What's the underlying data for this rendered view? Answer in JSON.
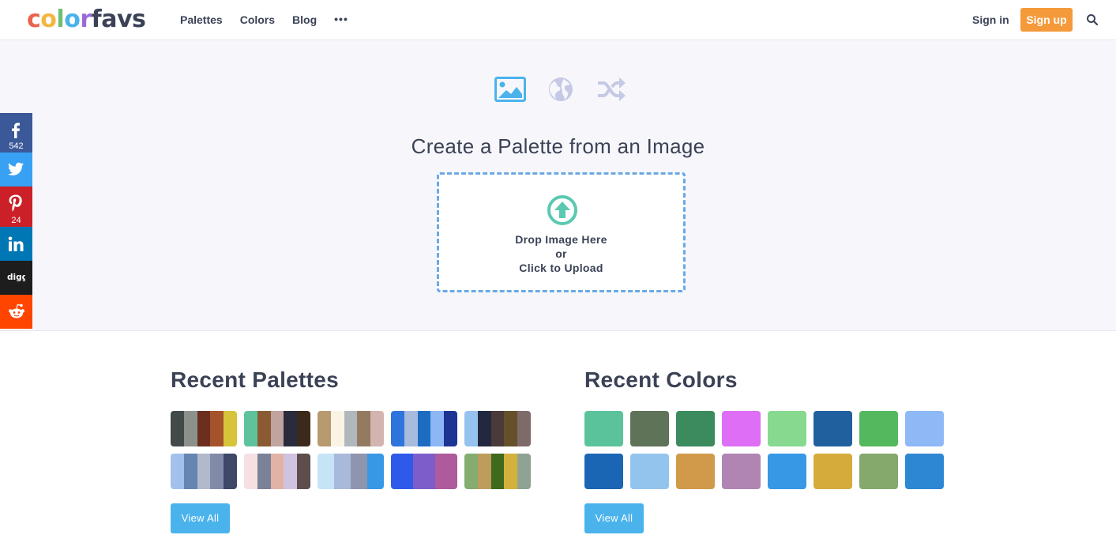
{
  "header": {
    "logo_letters": [
      {
        "ch": "c",
        "color": "#e9634a"
      },
      {
        "ch": "o",
        "color": "#f4b63f"
      },
      {
        "ch": "l",
        "color": "#6cc070"
      },
      {
        "ch": "o",
        "color": "#4ab3ec"
      },
      {
        "ch": "r",
        "color": "#9a6bd6"
      },
      {
        "ch": "f",
        "color": "#3b4256"
      },
      {
        "ch": "a",
        "color": "#3b4256"
      },
      {
        "ch": "v",
        "color": "#3b4256"
      },
      {
        "ch": "s",
        "color": "#3b4256"
      }
    ],
    "nav": [
      "Palettes",
      "Colors",
      "Blog"
    ],
    "more": "•••",
    "signin": "Sign in",
    "signup": "Sign up",
    "accent": "#f59a3a"
  },
  "hero": {
    "modes": [
      "image-icon",
      "globe-icon",
      "shuffle-icon"
    ],
    "title": "Create a Palette from an Image",
    "drop_line1": "Drop Image Here",
    "drop_line2": "or",
    "drop_line3": "Click to Upload"
  },
  "social": {
    "facebook_count": "542",
    "pinterest_count": "24"
  },
  "recent_palettes": {
    "title": "Recent Palettes",
    "button": "View All",
    "items": [
      [
        "#424a4a",
        "#8d918b",
        "#6b2e1f",
        "#a5532a",
        "#d8c43a"
      ],
      [
        "#5ec39c",
        "#8a5a33",
        "#c1a3a0",
        "#2a2b3c",
        "#3b2a1c"
      ],
      [
        "#b89a70",
        "#fbf4e4",
        "#b0b8bd",
        "#957a62",
        "#d3b4ae"
      ],
      [
        "#2f74dc",
        "#a9bbdd",
        "#1c6dc1",
        "#8cb6f4",
        "#1d3495"
      ],
      [
        "#95c2ee",
        "#232841",
        "#4a3a3a",
        "#65502a",
        "#7f6a6a"
      ],
      [
        "#a4c0ec",
        "#6686b1",
        "#b3b9cd",
        "#818ba8",
        "#404867"
      ],
      [
        "#f6e0e4",
        "#7b8298",
        "#e1b3a7",
        "#d0c3e1",
        "#5d4d4d"
      ],
      [
        "#c5e4f6",
        "#a9b9d9",
        "#8f95ae",
        "#3798e5"
      ],
      [
        "#2f59ea",
        "#7d5dc9",
        "#ae5a9d"
      ],
      [
        "#84ad6f",
        "#bd9c5c",
        "#3f6a1b",
        "#d3b13d",
        "#8fa293"
      ]
    ]
  },
  "recent_colors": {
    "title": "Recent Colors",
    "button": "View All",
    "items": [
      "#5bc39c",
      "#5e7358",
      "#3b8b5f",
      "#dd6ef5",
      "#86d98f",
      "#21609f",
      "#54b95e",
      "#8fb9f6",
      "#1b66b4",
      "#93c4ee",
      "#d09a4a",
      "#b085b4",
      "#3798e5",
      "#d5ab3b",
      "#85a86d",
      "#2d87d3"
    ]
  }
}
